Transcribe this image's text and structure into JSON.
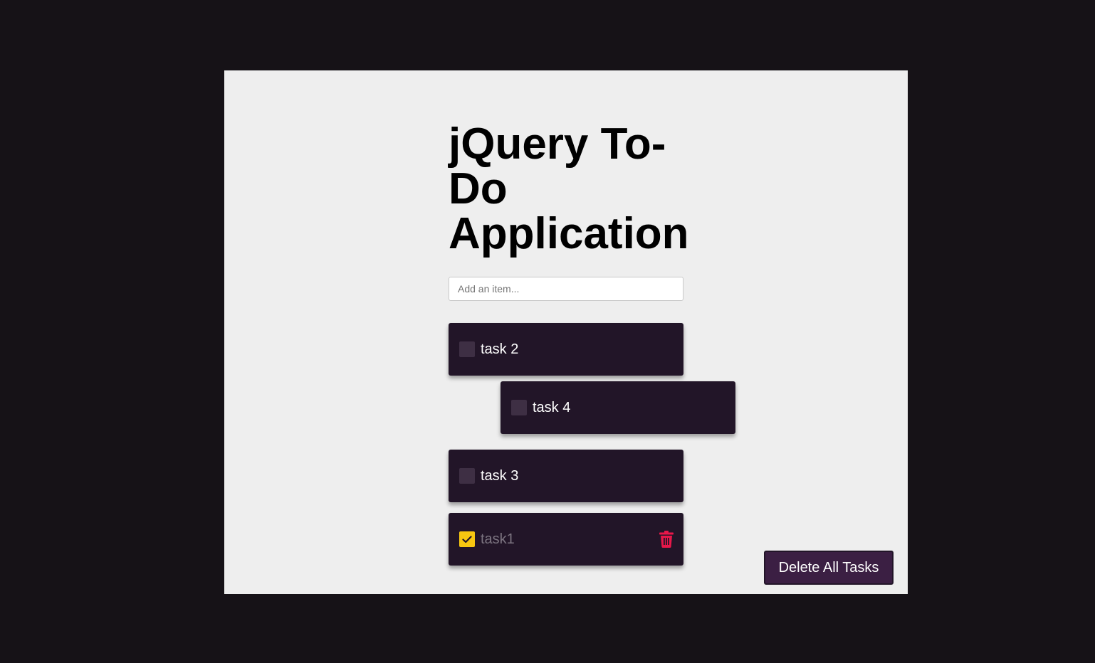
{
  "app": {
    "title": "jQuery To-Do Application"
  },
  "add_item": {
    "placeholder": "Add an item...",
    "value": ""
  },
  "tasks": [
    {
      "label": "task 2",
      "checked": false
    },
    {
      "label": "task 4",
      "checked": false
    },
    {
      "label": "task 3",
      "checked": false
    },
    {
      "label": "task1",
      "checked": true
    }
  ],
  "actions": {
    "delete_all_label": "Delete All Tasks"
  },
  "icons": {
    "checkbox_checked": "checkmark-icon",
    "delete_task": "trash-icon"
  },
  "colors": {
    "background": "#161217",
    "panel": "#eeeeee",
    "task_bg": "#221528",
    "checkbox_unchecked": "#3e2f44",
    "checkbox_checked": "#f7c611",
    "trash": "#e8174a",
    "delete_all_bg": "#3b1f43"
  }
}
